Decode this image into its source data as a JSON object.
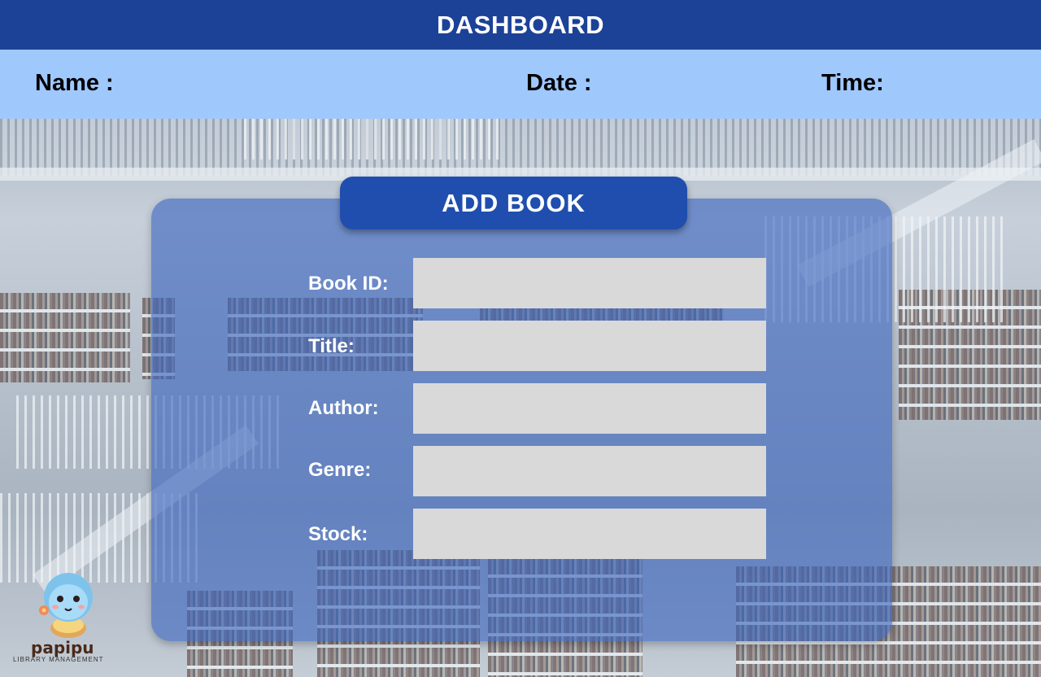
{
  "header": {
    "title": "DASHBOARD"
  },
  "info": {
    "name_label": "Name :",
    "date_label": "Date :",
    "time_label": "Time:"
  },
  "form": {
    "title": "ADD BOOK",
    "fields": [
      {
        "label": "Book ID:",
        "value": ""
      },
      {
        "label": "Title:",
        "value": ""
      },
      {
        "label": "Author:",
        "value": ""
      },
      {
        "label": "Genre:",
        "value": ""
      },
      {
        "label": "Stock:",
        "value": ""
      }
    ]
  },
  "logo": {
    "brand": "papipu",
    "tagline": "LIBRARY MANAGEMENT",
    "icon": "turtle-mascot-icon"
  },
  "colors": {
    "header_bg": "#1c4297",
    "infobar_bg": "#9fc8fd",
    "panel_bg": "#3a64be",
    "panel_title_bg": "#1f4eae",
    "input_bg": "#d9d9d9"
  }
}
